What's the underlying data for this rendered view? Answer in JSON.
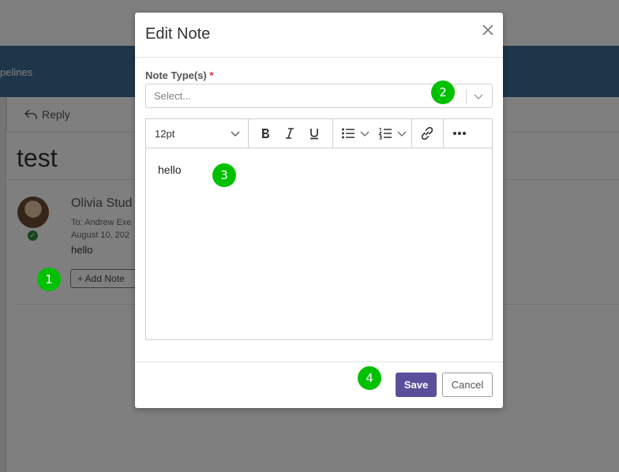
{
  "background": {
    "nav_text": "pelines",
    "reply_label": "Reply",
    "subject": "test",
    "sender": "Olivia Stud",
    "to": "To: Andrew Exe",
    "date": "August 10, 202",
    "body": "hello",
    "add_note_label": "+ Add Note"
  },
  "modal": {
    "title": "Edit Note",
    "close_icon": "close-icon",
    "note_type": {
      "label": "Note Type(s)",
      "required_mark": "*",
      "placeholder": "Select..."
    },
    "editor": {
      "font_size": "12pt",
      "toolbar_icons": [
        "bold-icon",
        "italic-icon",
        "underline-icon",
        "bullet-list-icon",
        "numbered-list-icon",
        "link-icon",
        "more-icon"
      ],
      "content": "hello"
    },
    "save_label": "Save",
    "cancel_label": "Cancel"
  },
  "markers": [
    "1",
    "2",
    "3",
    "4"
  ],
  "colors": {
    "navbar": "#3d6d95",
    "save_button": "#5b4f9c",
    "marker": "#00c000",
    "required": "#d62c2c"
  }
}
